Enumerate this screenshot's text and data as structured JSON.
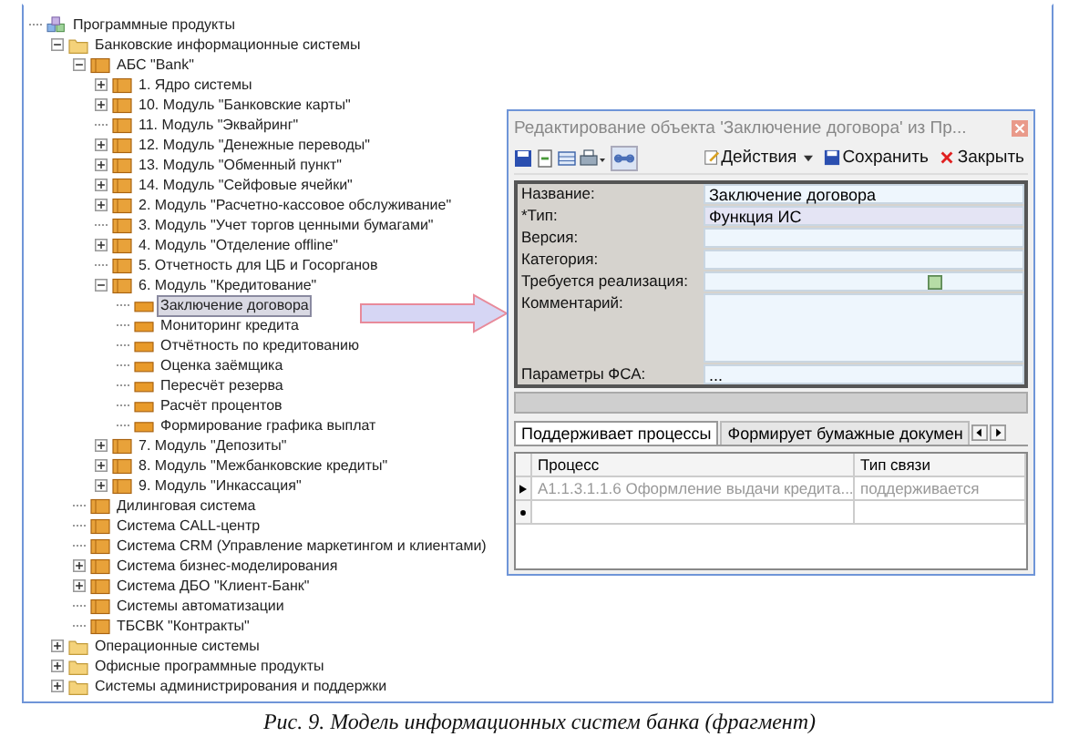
{
  "tree": [
    {
      "label": "Программные продукты",
      "kind": "root",
      "selected": false,
      "children": [
        {
          "label": "Банковские информационные системы",
          "kind": "folder",
          "expanded": true,
          "selected": false,
          "children": [
            {
              "label": "АБС \"Bank\"",
              "kind": "module",
              "expanded": true,
              "selected": false,
              "children": [
                {
                  "label": "1. Ядро системы",
                  "kind": "module",
                  "expanded": false,
                  "selected": false
                },
                {
                  "label": "10. Модуль \"Банковские карты\"",
                  "kind": "module",
                  "expanded": false,
                  "selected": false
                },
                {
                  "label": "11. Модуль \"Эквайринг\"",
                  "kind": "module",
                  "selected": false
                },
                {
                  "label": "12. Модуль \"Денежные переводы\"",
                  "kind": "module",
                  "expanded": false,
                  "selected": false
                },
                {
                  "label": "13. Модуль \"Обменный пункт\"",
                  "kind": "module",
                  "expanded": false,
                  "selected": false
                },
                {
                  "label": "14.  Модуль \"Сейфовые ячейки\"",
                  "kind": "module",
                  "expanded": false,
                  "selected": false
                },
                {
                  "label": "2. Модуль \"Расчетно-кассовое обслуживание\"",
                  "kind": "module",
                  "expanded": false,
                  "selected": false
                },
                {
                  "label": "3. Модуль \"Учет торгов ценными бумагами\"",
                  "kind": "module",
                  "selected": false
                },
                {
                  "label": "4. Модуль \"Отделение offline\"",
                  "kind": "module",
                  "expanded": false,
                  "selected": false
                },
                {
                  "label": "5. Отчетность для ЦБ и Госорганов",
                  "kind": "module",
                  "selected": false
                },
                {
                  "label": "6. Модуль \"Кредитование\"",
                  "kind": "module",
                  "expanded": true,
                  "selected": false,
                  "children": [
                    {
                      "label": "Заключение договора",
                      "kind": "function",
                      "selected": true
                    },
                    {
                      "label": "Мониторинг кредита",
                      "kind": "function",
                      "selected": false
                    },
                    {
                      "label": "Отчётность по кредитованию",
                      "kind": "function",
                      "selected": false
                    },
                    {
                      "label": "Оценка заёмщика",
                      "kind": "function",
                      "selected": false
                    },
                    {
                      "label": "Пересчёт резерва",
                      "kind": "function",
                      "selected": false
                    },
                    {
                      "label": "Расчёт процентов",
                      "kind": "function",
                      "selected": false
                    },
                    {
                      "label": "Формирование графика выплат",
                      "kind": "function",
                      "selected": false
                    }
                  ]
                },
                {
                  "label": "7. Модуль \"Депозиты\"",
                  "kind": "module",
                  "expanded": false,
                  "selected": false
                },
                {
                  "label": "8. Модуль \"Межбанковские кредиты\"",
                  "kind": "module",
                  "expanded": false,
                  "selected": false
                },
                {
                  "label": "9. Модуль \"Инкассация\"",
                  "kind": "module",
                  "expanded": false,
                  "selected": false
                }
              ]
            },
            {
              "label": "Дилинговая система",
              "kind": "module",
              "selected": false
            },
            {
              "label": "Система CALL-центр",
              "kind": "module",
              "selected": false
            },
            {
              "label": "Система CRM (Управление маркетингом и клиентами)",
              "kind": "module",
              "selected": false
            },
            {
              "label": "Система бизнес-моделирования",
              "kind": "module",
              "expanded": false,
              "selected": false
            },
            {
              "label": "Система ДБО \"Клиент-Банк\"",
              "kind": "module",
              "expanded": false,
              "selected": false
            },
            {
              "label": "Системы автоматизации",
              "kind": "module",
              "selected": false
            },
            {
              "label": "ТБСВК \"Контракты\"",
              "kind": "module",
              "selected": false
            }
          ]
        },
        {
          "label": "Операционные системы",
          "kind": "folder",
          "expanded": false,
          "selected": false
        },
        {
          "label": "Офисные программные продукты",
          "kind": "folder",
          "expanded": false,
          "selected": false
        },
        {
          "label": "Системы администрирования и поддержки",
          "kind": "folder",
          "expanded": false,
          "selected": false
        }
      ]
    }
  ],
  "dialog": {
    "title": "Редактирование объекта 'Заключение договора' из Пр...",
    "toolbar": [
      {
        "label": "Действия",
        "kind": "actions"
      },
      {
        "label": "Сохранить",
        "kind": "save"
      },
      {
        "label": "Закрыть",
        "kind": "close"
      }
    ],
    "fields": [
      {
        "label": "Название:",
        "kind": "text",
        "value": "Заключение договора",
        "highlighted": false
      },
      {
        "label": "*Тип:",
        "kind": "text",
        "value": "Функция ИС",
        "highlighted": true
      },
      {
        "label": "Версия:",
        "kind": "text",
        "highlighted": false
      },
      {
        "label": "Категория:",
        "kind": "text",
        "highlighted": false
      },
      {
        "label": "Требуется реализация:",
        "kind": "checkbox",
        "checked": false,
        "highlighted": false
      },
      {
        "label": "Комментарий:",
        "kind": "memo",
        "highlighted": false
      },
      {
        "label": "Параметры ФСА:",
        "kind": "text",
        "value": "...",
        "highlighted": false
      }
    ],
    "tabs": [
      {
        "label": "Поддерживает процессы",
        "selected": true
      },
      {
        "label": "Формирует бумажные докумен",
        "selected": false
      }
    ],
    "table": {
      "columns": [
        "Процесс",
        "Тип связи"
      ],
      "rows": [
        [
          "А1.1.3.1.1.6 Оформление выдачи кредита...",
          "поддерживается"
        ]
      ]
    }
  },
  "caption": "Рис. 9. Модель информационных систем банка (фрагмент)"
}
